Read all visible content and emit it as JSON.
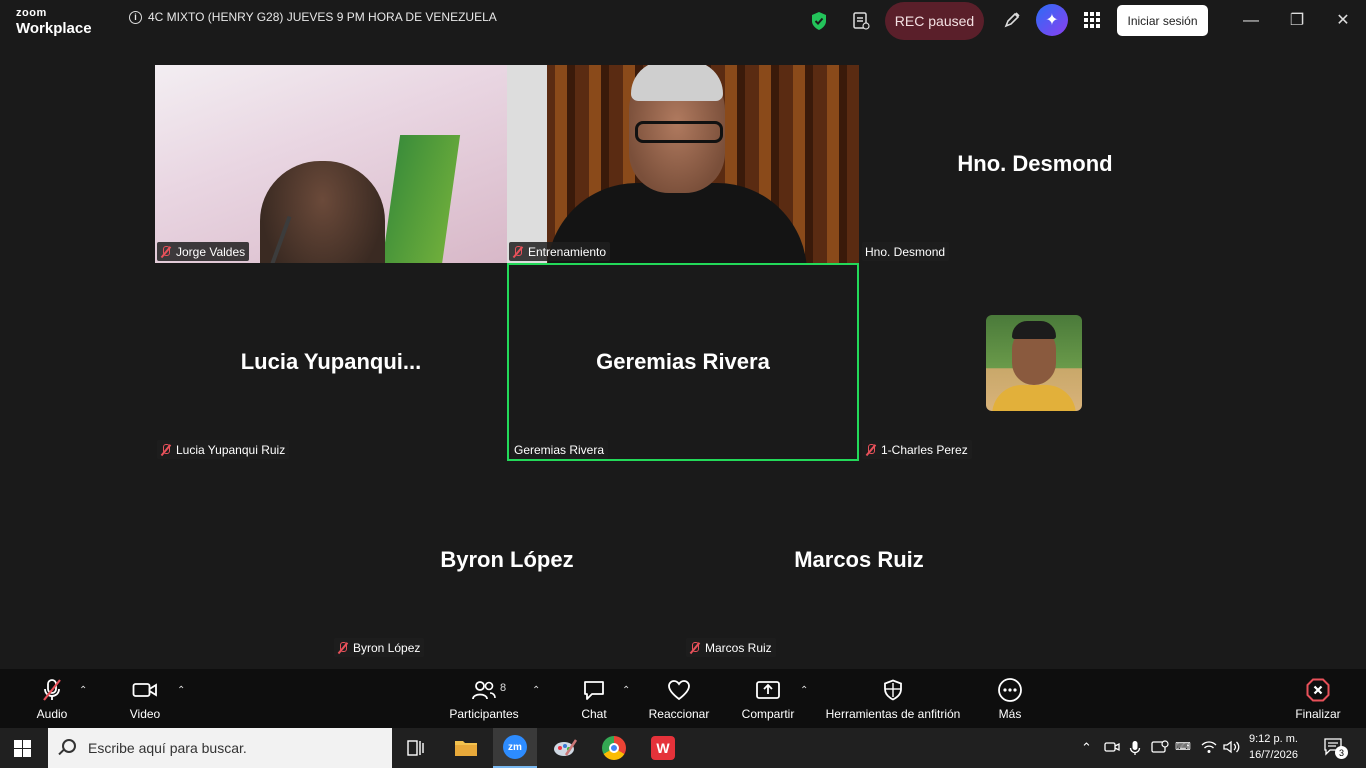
{
  "app": {
    "logo_line1": "zoom",
    "logo_line2": "Workplace"
  },
  "meeting": {
    "title": "4C MIXTO (HENRY G28) JUEVES 9 PM HORA DE VENEZUELA"
  },
  "titlebar": {
    "rec_label": "REC paused",
    "signin_label": "Iniciar sesión",
    "icons": [
      "info-icon",
      "shield-check-icon",
      "document-icon",
      "pen-icon",
      "ai-companion-icon",
      "apps-grid-icon"
    ]
  },
  "participants": [
    {
      "name": "Jorge Valdes",
      "tag": "Jorge Valdes",
      "muted": true,
      "video": true
    },
    {
      "name": "Entrenamiento",
      "tag": "Entrenamiento",
      "muted": true,
      "video": true
    },
    {
      "name": "Hno. Desmond",
      "tag": "Hno. Desmond",
      "muted": false,
      "display": "Hno. Desmond"
    },
    {
      "name": "Lucia Yupanqui Ruiz",
      "tag": "Lucia Yupanqui Ruiz",
      "muted": true,
      "display": "Lucia  Yupanqui..."
    },
    {
      "name": "Geremias Rivera",
      "tag": "Geremias Rivera",
      "muted": false,
      "display": "Geremias Rivera",
      "active_speaker": true
    },
    {
      "name": "1-Charles Perez",
      "tag": "1-Charles Perez",
      "muted": true,
      "avatar": true
    },
    {
      "name": "Byron López",
      "tag": "Byron López",
      "muted": true,
      "display": "Byron López"
    },
    {
      "name": "Marcos Ruiz",
      "tag": "Marcos Ruiz",
      "muted": true,
      "display": "Marcos Ruiz"
    }
  ],
  "toolbar": {
    "audio": "Audio",
    "video": "Video",
    "participants": "Participantes",
    "participants_count": "8",
    "chat": "Chat",
    "react": "Reaccionar",
    "share": "Compartir",
    "host_tools": "Herramientas de anfitrión",
    "more": "Más",
    "end": "Finalizar"
  },
  "taskbar": {
    "search_placeholder": "Escribe aquí para buscar.",
    "time": "9:12 p. m.",
    "date": "16/7/2026",
    "notifications": "3"
  },
  "colors": {
    "active_speaker": "#23d959",
    "rec_bg": "#5a1f2a",
    "muted": "#e8515a",
    "end": "#e8515a"
  }
}
